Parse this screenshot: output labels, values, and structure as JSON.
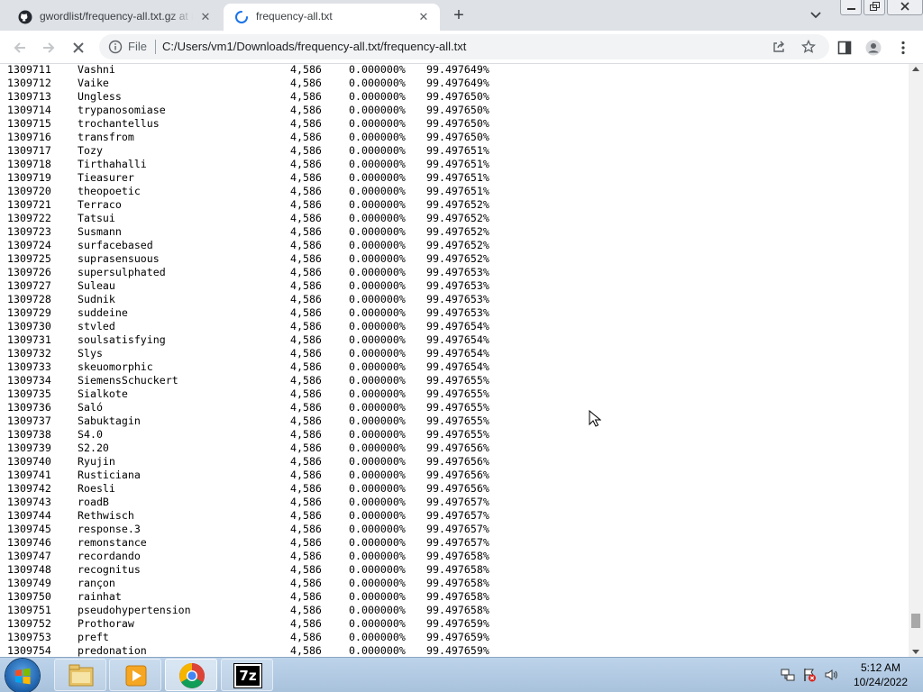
{
  "browser": {
    "tabs": [
      {
        "title": "gwordlist/frequency-all.txt.gz at master",
        "icon": "github-icon",
        "active": false
      },
      {
        "title": "frequency-all.txt",
        "icon": "loading-spinner-icon",
        "active": true
      }
    ],
    "close_glyph": "✕",
    "new_tab_glyph": "+",
    "address": {
      "scheme_label": "File",
      "url": "C:/Users/vm1/Downloads/frequency-all.txt/frequency-all.txt"
    }
  },
  "rows": [
    {
      "id": "1309711",
      "word": "Vashni",
      "count": "4,586",
      "pct": "0.000000%",
      "cum": "99.497649%"
    },
    {
      "id": "1309712",
      "word": "Vaike",
      "count": "4,586",
      "pct": "0.000000%",
      "cum": "99.497649%"
    },
    {
      "id": "1309713",
      "word": "Ungless",
      "count": "4,586",
      "pct": "0.000000%",
      "cum": "99.497650%"
    },
    {
      "id": "1309714",
      "word": "trypanosomiase",
      "count": "4,586",
      "pct": "0.000000%",
      "cum": "99.497650%"
    },
    {
      "id": "1309715",
      "word": "trochantellus",
      "count": "4,586",
      "pct": "0.000000%",
      "cum": "99.497650%"
    },
    {
      "id": "1309716",
      "word": "transfrom",
      "count": "4,586",
      "pct": "0.000000%",
      "cum": "99.497650%"
    },
    {
      "id": "1309717",
      "word": "Tozy",
      "count": "4,586",
      "pct": "0.000000%",
      "cum": "99.497651%"
    },
    {
      "id": "1309718",
      "word": "Tirthahalli",
      "count": "4,586",
      "pct": "0.000000%",
      "cum": "99.497651%"
    },
    {
      "id": "1309719",
      "word": "Tieasurer",
      "count": "4,586",
      "pct": "0.000000%",
      "cum": "99.497651%"
    },
    {
      "id": "1309720",
      "word": "theopoetic",
      "count": "4,586",
      "pct": "0.000000%",
      "cum": "99.497651%"
    },
    {
      "id": "1309721",
      "word": "Terraco",
      "count": "4,586",
      "pct": "0.000000%",
      "cum": "99.497652%"
    },
    {
      "id": "1309722",
      "word": "Tatsui",
      "count": "4,586",
      "pct": "0.000000%",
      "cum": "99.497652%"
    },
    {
      "id": "1309723",
      "word": "Susmann",
      "count": "4,586",
      "pct": "0.000000%",
      "cum": "99.497652%"
    },
    {
      "id": "1309724",
      "word": "surfacebased",
      "count": "4,586",
      "pct": "0.000000%",
      "cum": "99.497652%"
    },
    {
      "id": "1309725",
      "word": "suprasensuous",
      "count": "4,586",
      "pct": "0.000000%",
      "cum": "99.497652%"
    },
    {
      "id": "1309726",
      "word": "supersulphated",
      "count": "4,586",
      "pct": "0.000000%",
      "cum": "99.497653%"
    },
    {
      "id": "1309727",
      "word": "Suleau",
      "count": "4,586",
      "pct": "0.000000%",
      "cum": "99.497653%"
    },
    {
      "id": "1309728",
      "word": "Sudnik",
      "count": "4,586",
      "pct": "0.000000%",
      "cum": "99.497653%"
    },
    {
      "id": "1309729",
      "word": "suddeine",
      "count": "4,586",
      "pct": "0.000000%",
      "cum": "99.497653%"
    },
    {
      "id": "1309730",
      "word": "stvled",
      "count": "4,586",
      "pct": "0.000000%",
      "cum": "99.497654%"
    },
    {
      "id": "1309731",
      "word": "soulsatisfying",
      "count": "4,586",
      "pct": "0.000000%",
      "cum": "99.497654%"
    },
    {
      "id": "1309732",
      "word": "Slys",
      "count": "4,586",
      "pct": "0.000000%",
      "cum": "99.497654%"
    },
    {
      "id": "1309733",
      "word": "skeuomorphic",
      "count": "4,586",
      "pct": "0.000000%",
      "cum": "99.497654%"
    },
    {
      "id": "1309734",
      "word": "SiemensSchuckert",
      "count": "4,586",
      "pct": "0.000000%",
      "cum": "99.497655%"
    },
    {
      "id": "1309735",
      "word": "Sialkote",
      "count": "4,586",
      "pct": "0.000000%",
      "cum": "99.497655%"
    },
    {
      "id": "1309736",
      "word": "Saló",
      "count": "4,586",
      "pct": "0.000000%",
      "cum": "99.497655%"
    },
    {
      "id": "1309737",
      "word": "Sabuktagin",
      "count": "4,586",
      "pct": "0.000000%",
      "cum": "99.497655%"
    },
    {
      "id": "1309738",
      "word": "S4.0",
      "count": "4,586",
      "pct": "0.000000%",
      "cum": "99.497655%"
    },
    {
      "id": "1309739",
      "word": "S2.20",
      "count": "4,586",
      "pct": "0.000000%",
      "cum": "99.497656%"
    },
    {
      "id": "1309740",
      "word": "Ryujin",
      "count": "4,586",
      "pct": "0.000000%",
      "cum": "99.497656%"
    },
    {
      "id": "1309741",
      "word": "Rusticiana",
      "count": "4,586",
      "pct": "0.000000%",
      "cum": "99.497656%"
    },
    {
      "id": "1309742",
      "word": "Roesli",
      "count": "4,586",
      "pct": "0.000000%",
      "cum": "99.497656%"
    },
    {
      "id": "1309743",
      "word": "roadB",
      "count": "4,586",
      "pct": "0.000000%",
      "cum": "99.497657%"
    },
    {
      "id": "1309744",
      "word": "Rethwisch",
      "count": "4,586",
      "pct": "0.000000%",
      "cum": "99.497657%"
    },
    {
      "id": "1309745",
      "word": "response.3",
      "count": "4,586",
      "pct": "0.000000%",
      "cum": "99.497657%"
    },
    {
      "id": "1309746",
      "word": "remonstance",
      "count": "4,586",
      "pct": "0.000000%",
      "cum": "99.497657%"
    },
    {
      "id": "1309747",
      "word": "recordando",
      "count": "4,586",
      "pct": "0.000000%",
      "cum": "99.497658%"
    },
    {
      "id": "1309748",
      "word": "recognitus",
      "count": "4,586",
      "pct": "0.000000%",
      "cum": "99.497658%"
    },
    {
      "id": "1309749",
      "word": "rançon",
      "count": "4,586",
      "pct": "0.000000%",
      "cum": "99.497658%"
    },
    {
      "id": "1309750",
      "word": "rainhat",
      "count": "4,586",
      "pct": "0.000000%",
      "cum": "99.497658%"
    },
    {
      "id": "1309751",
      "word": "pseudohypertension",
      "count": "4,586",
      "pct": "0.000000%",
      "cum": "99.497658%"
    },
    {
      "id": "1309752",
      "word": "Prothoraw",
      "count": "4,586",
      "pct": "0.000000%",
      "cum": "99.497659%"
    },
    {
      "id": "1309753",
      "word": "preft",
      "count": "4,586",
      "pct": "0.000000%",
      "cum": "99.497659%"
    },
    {
      "id": "1309754",
      "word": "predonation",
      "count": "4,586",
      "pct": "0.000000%",
      "cum": "99.497659%"
    }
  ],
  "taskbar": {
    "items": [
      {
        "icon": "file-explorer-icon"
      },
      {
        "icon": "media-player-icon"
      },
      {
        "icon": "chrome-icon"
      },
      {
        "icon": "7zip-icon",
        "label": "7z"
      }
    ],
    "clock": {
      "time": "5:12 AM",
      "date": "10/24/2022"
    }
  }
}
